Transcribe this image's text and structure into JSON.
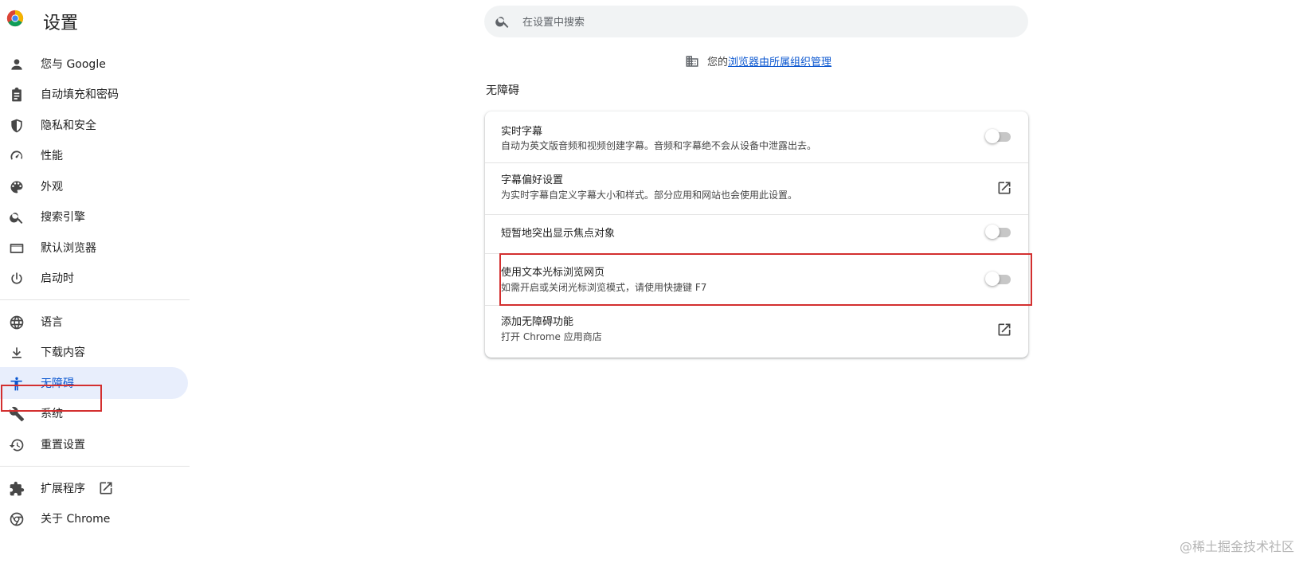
{
  "app": {
    "title": "设置"
  },
  "search": {
    "placeholder": "在设置中搜索",
    "value": ""
  },
  "sidebar": {
    "items": [
      {
        "label": "您与 Google",
        "icon": "person-icon"
      },
      {
        "label": "自动填充和密码",
        "icon": "clipboard-icon"
      },
      {
        "label": "隐私和安全",
        "icon": "shield-icon"
      },
      {
        "label": "性能",
        "icon": "speedometer-icon"
      },
      {
        "label": "外观",
        "icon": "palette-icon"
      },
      {
        "label": "搜索引擎",
        "icon": "search-icon"
      },
      {
        "label": "默认浏览器",
        "icon": "browser-window-icon"
      },
      {
        "label": "启动时",
        "icon": "power-icon"
      },
      {
        "label": "语言",
        "icon": "globe-icon"
      },
      {
        "label": "下载内容",
        "icon": "download-icon"
      },
      {
        "label": "无障碍",
        "icon": "accessibility-icon",
        "active": true
      },
      {
        "label": "系统",
        "icon": "wrench-icon"
      },
      {
        "label": "重置设置",
        "icon": "history-icon"
      },
      {
        "label": "扩展程序",
        "icon": "puzzle-icon",
        "external": true
      },
      {
        "label": "关于 Chrome",
        "icon": "chrome-icon"
      }
    ]
  },
  "managed": {
    "prefix": "您的",
    "link": "浏览器由所属组织管理",
    "icon": "building-icon"
  },
  "section": {
    "title": "无障碍",
    "rows": [
      {
        "title": "实时字幕",
        "subtitle": "自动为英文版音频和视频创建字幕。音频和字幕绝不会从设备中泄露出去。",
        "control": "toggle",
        "checked": false
      },
      {
        "title": "字幕偏好设置",
        "subtitle": "为实时字幕自定义字幕大小和样式。部分应用和网站也会使用此设置。",
        "control": "launch"
      },
      {
        "title": "短暂地突出显示焦点对象",
        "subtitle": "",
        "control": "toggle",
        "checked": false
      },
      {
        "title": "使用文本光标浏览网页",
        "subtitle": "如需开启或关闭光标浏览模式，请使用快捷键 F7",
        "control": "toggle",
        "checked": false
      },
      {
        "title": "添加无障碍功能",
        "subtitle": "打开 Chrome 应用商店",
        "control": "launch"
      }
    ]
  },
  "colors": {
    "accent": "#0b57d0",
    "active_bg": "#e8eefc",
    "highlight": "#d32f2f"
  },
  "watermark": "@稀土掘金技术社区"
}
